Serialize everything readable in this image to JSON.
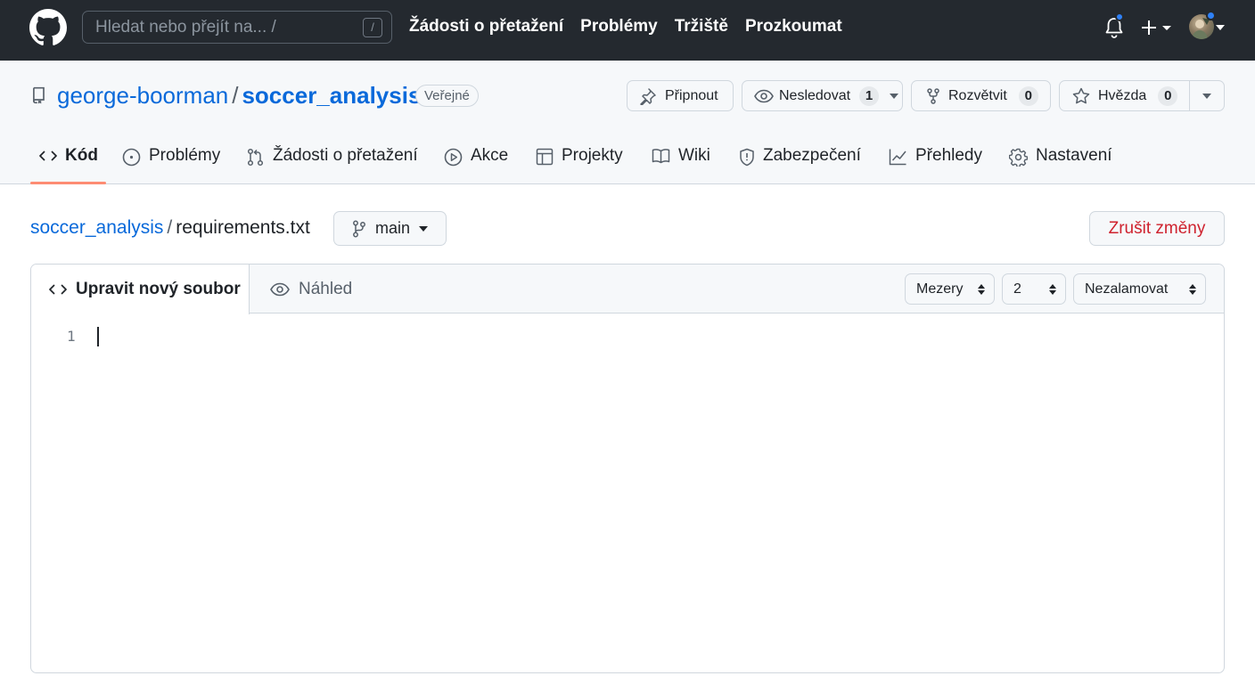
{
  "header": {
    "search_placeholder": "Hledat nebo přejít na... /",
    "search_shortcut": "/",
    "nav": [
      "Žádosti o přetažení",
      "Problémy",
      "Tržiště",
      "Prozkoumat"
    ]
  },
  "repo": {
    "owner": "george-boorman",
    "separator": "/",
    "name": "soccer_analysis",
    "visibility": "Veřejné",
    "actions": {
      "pin": "Připnout",
      "watch": "Nesledovat",
      "watch_count": "1",
      "fork": "Rozvětvit",
      "fork_count": "0",
      "star": "Hvězda",
      "star_count": "0"
    },
    "tabs": [
      "Kód",
      "Problémy",
      "Žádosti o přetažení",
      "Akce",
      "Projekty",
      "Wiki",
      "Zabezpečení",
      "Přehledy",
      "Nastavení"
    ]
  },
  "editor": {
    "breadcrumb_repo": "soccer_analysis",
    "breadcrumb_sep": "/",
    "filename": "requirements.txt",
    "branch": "main",
    "cancel_label": "Zrušit změny",
    "tab_edit": "Upravit nový soubor",
    "tab_preview": "Náhled",
    "indent_mode": "Mezery",
    "indent_size": "2",
    "wrap_mode": "Nezalamovat",
    "line_numbers": [
      "1"
    ]
  },
  "colors": {
    "header_bg": "#24292f",
    "link": "#0969da",
    "danger": "#cf222e",
    "tab_underline": "#fd8c73",
    "notification_dot": "#2f81f7"
  }
}
